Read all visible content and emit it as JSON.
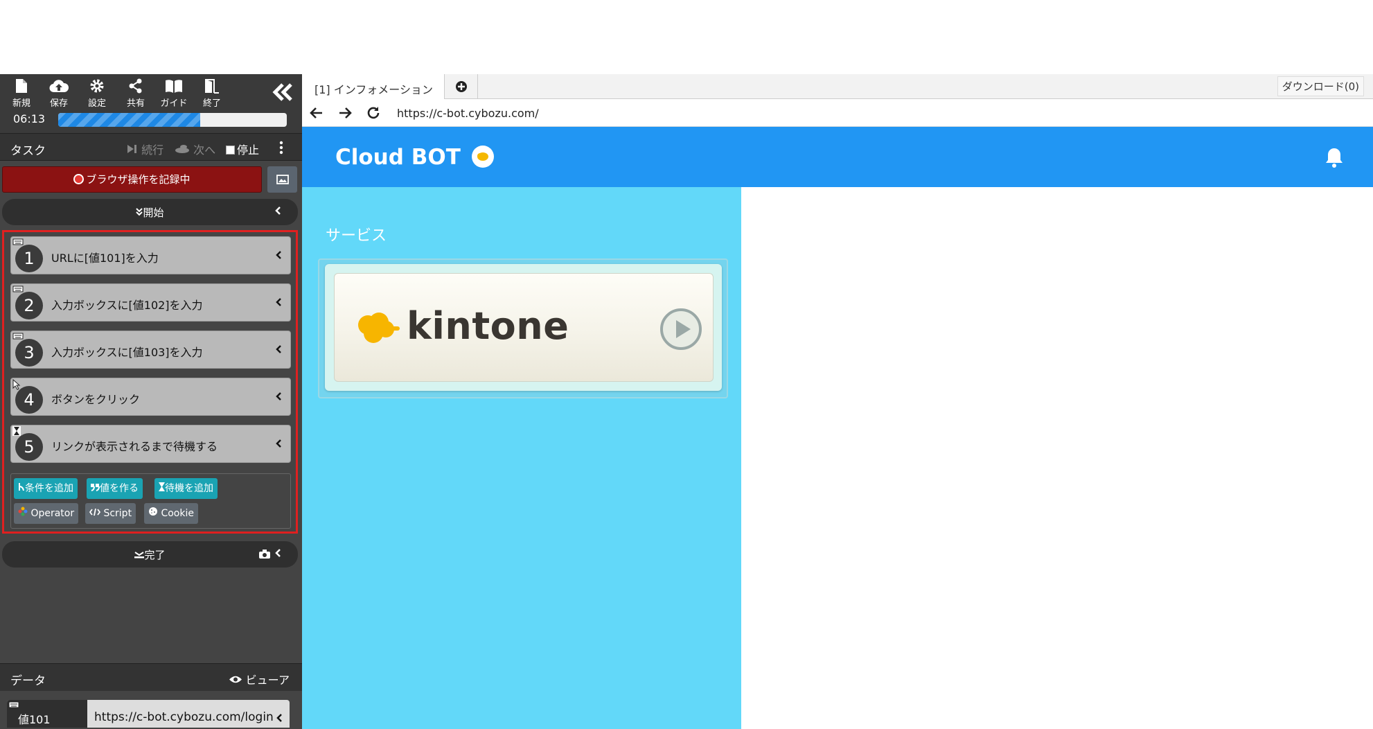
{
  "toolbar": {
    "new_label": "新規",
    "save_label": "保存",
    "settings_label": "設定",
    "share_label": "共有",
    "guide_label": "ガイド",
    "exit_label": "終了"
  },
  "timer": "06:13",
  "progress_fraction": 0.62,
  "task": {
    "title": "タスク",
    "continue_label": "続行",
    "next_label": "次へ",
    "stop_label": "停止"
  },
  "record_label": "ブラウザ操作を記録中",
  "start_label": "開始",
  "steps": [
    {
      "num": "1",
      "text": "URLに[値101]を入力",
      "icon": "keyboard-icon"
    },
    {
      "num": "2",
      "text": "入力ボックスに[値102]を入力",
      "icon": "keyboard-icon"
    },
    {
      "num": "3",
      "text": "入力ボックスに[値103]を入力",
      "icon": "keyboard-icon"
    },
    {
      "num": "4",
      "text": "ボタンをクリック",
      "icon": "cursor-icon"
    },
    {
      "num": "5",
      "text": "リンクが表示されるまで待機する",
      "icon": "hourglass-icon"
    }
  ],
  "add_buttons": {
    "condition": "条件を追加",
    "value": "値を作る",
    "wait": "待機を追加",
    "operator": "Operator",
    "script": "Script",
    "cookie": "Cookie"
  },
  "finish_label": "完了",
  "data": {
    "title": "データ",
    "viewer_label": "ビューア",
    "rows": [
      {
        "key": "値101",
        "value": "https://c-bot.cybozu.com/login"
      }
    ]
  },
  "browser": {
    "tab_label": "[1] インフォメーション",
    "download_label": "ダウンロード(0)",
    "url": "https://c-bot.cybozu.com/"
  },
  "site": {
    "logo": "Cloud BOT",
    "service_heading": "サービス",
    "service_name": "kintone"
  },
  "colors": {
    "header_blue": "#2196f3",
    "side_cyan": "#62d8f9",
    "record_red": "#8b1212",
    "highlight_red": "#e02020",
    "teal_button": "#1aa3b3"
  }
}
